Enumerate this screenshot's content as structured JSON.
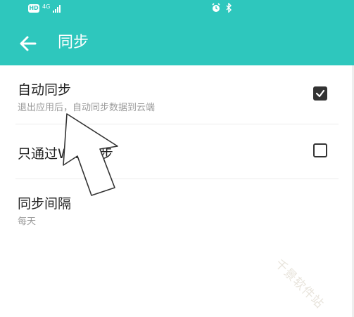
{
  "status_bar": {
    "hd_badge": "HD",
    "network": "4G",
    "icons": [
      "hd-badge",
      "signal-icon",
      "alarm-icon",
      "bluetooth-icon"
    ]
  },
  "app_bar": {
    "title": "同步",
    "back_icon": "arrow-left-icon",
    "background": "#2ec7bd"
  },
  "settings": [
    {
      "title": "自动同步",
      "subtitle": "退出应用后，自动同步数据到云端",
      "checked": true
    },
    {
      "title": "只通过WIFI同步",
      "checked": false
    },
    {
      "title": "同步间隔",
      "subtitle": "每天"
    }
  ],
  "watermark": "千景软件站"
}
